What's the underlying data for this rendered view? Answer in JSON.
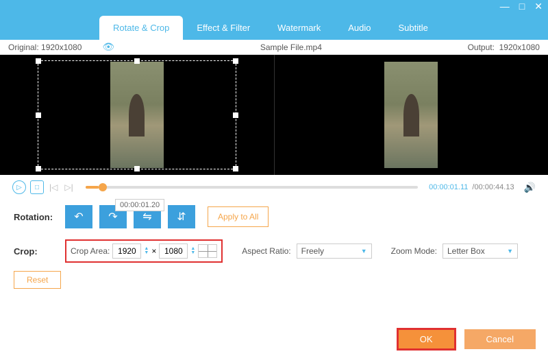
{
  "titlebar": {
    "min": "—",
    "max": "□",
    "close": "✕"
  },
  "tabs": {
    "rotate": "Rotate & Crop",
    "effect": "Effect & Filter",
    "watermark": "Watermark",
    "audio": "Audio",
    "subtitle": "Subtitle"
  },
  "info": {
    "original_label": "Original:",
    "original": "1920x1080",
    "file": "Sample File.mp4",
    "output_label": "Output:",
    "output": "1920x1080"
  },
  "timeline": {
    "current": "00:00:01.11",
    "total": "/00:00:44.13",
    "marker": "00:00:01.20"
  },
  "rotation": {
    "label": "Rotation:",
    "apply": "Apply to All"
  },
  "crop": {
    "label": "Crop:",
    "area_label": "Crop Area:",
    "w": "1920",
    "x": "×",
    "h": "1080",
    "aspect_label": "Aspect Ratio:",
    "aspect": "Freely",
    "zoom_label": "Zoom Mode:",
    "zoom": "Letter Box",
    "reset": "Reset"
  },
  "footer": {
    "ok": "OK",
    "cancel": "Cancel"
  },
  "icons": {
    "play": "▷",
    "stop": "□",
    "prev": "|◁",
    "next": "▷|",
    "rot_ccw": "↶",
    "rot_cw": "↷",
    "flip_h": "⇋",
    "flip_v": "⇵",
    "eye": "👁",
    "speaker": "🔊",
    "up": "▲",
    "down": "▼",
    "drop": "▼"
  }
}
